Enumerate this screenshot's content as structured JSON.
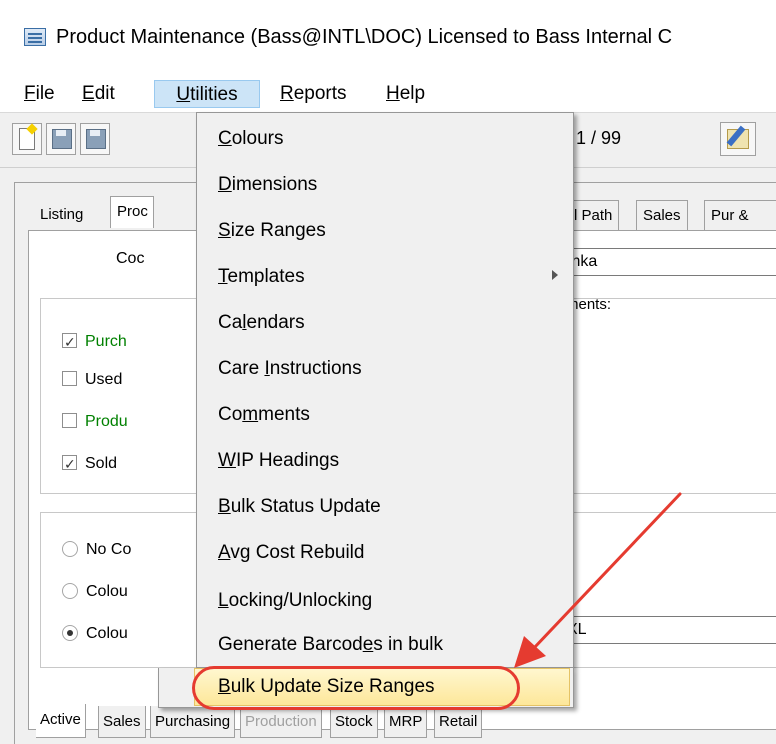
{
  "window": {
    "title": "Product Maintenance (Bass@INTL\\DOC) Licensed to Bass Internal C"
  },
  "menubar": {
    "items": [
      {
        "label": "File",
        "accel": "F",
        "rest": "ile"
      },
      {
        "label": "Edit",
        "accel": "E",
        "rest": "dit"
      },
      {
        "label": "Utilities",
        "accel": "U",
        "rest": "tilities"
      },
      {
        "label": "Reports",
        "accel": "R",
        "rest": "eports"
      },
      {
        "label": "Help",
        "accel": "H",
        "rest": "elp"
      }
    ]
  },
  "toolbar": {
    "record_counter": "1 / 99"
  },
  "tabs_top": {
    "listing": "Listing",
    "prod": "Proc",
    "path": "l Path",
    "sales": "Sales",
    "pur": "Pur &"
  },
  "form": {
    "code_label": "Coc",
    "code_value": "Inka",
    "comments_label": "ments:",
    "size_value": "XL",
    "checks": [
      {
        "label": "Purch",
        "checked": true,
        "green": true
      },
      {
        "label": "Used",
        "checked": false,
        "green": false
      },
      {
        "label": "Produ",
        "checked": false,
        "green": true
      },
      {
        "label": "Sold",
        "checked": true,
        "green": false
      }
    ],
    "radios": [
      {
        "label": "No Co",
        "selected": false
      },
      {
        "label": "Colou",
        "selected": false
      },
      {
        "label": "Colou",
        "selected": true
      }
    ]
  },
  "tabs_bottom": [
    "Active",
    "Sales",
    "Purchasing",
    "Production",
    "Stock",
    "MRP",
    "Retail"
  ],
  "utilities_menu": {
    "items": [
      {
        "pre": "",
        "accel": "C",
        "post": "olours"
      },
      {
        "pre": "",
        "accel": "D",
        "post": "imensions"
      },
      {
        "pre": "",
        "accel": "S",
        "post": "ize Ranges"
      },
      {
        "pre": "",
        "accel": "T",
        "post": "emplates"
      },
      {
        "pre": "Ca",
        "accel": "l",
        "post": "endars"
      },
      {
        "pre": "Care ",
        "accel": "I",
        "post": "nstructions"
      },
      {
        "pre": "Co",
        "accel": "m",
        "post": "ments"
      },
      {
        "pre": "",
        "accel": "W",
        "post": "IP Headings"
      },
      {
        "pre": "",
        "accel": "B",
        "post": "ulk Status Update"
      },
      {
        "pre": "",
        "accel": "A",
        "post": "vg Cost Rebuild"
      },
      {
        "pre": "",
        "accel": "L",
        "post": "ocking/Unlocking"
      },
      {
        "pre": "Generate Barcod",
        "accel": "e",
        "post": "s in bulk"
      },
      {
        "pre": "",
        "accel": "B",
        "post": "ulk Update Size Ranges"
      }
    ]
  },
  "colors": {
    "annotation": "#e53b30",
    "menu_highlight": "#fde79a",
    "green_text": "#008000"
  }
}
